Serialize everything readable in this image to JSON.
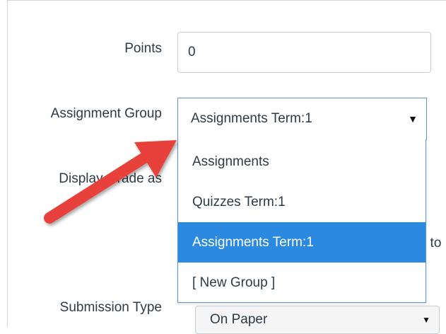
{
  "form": {
    "points": {
      "label": "Points",
      "value": "0"
    },
    "assignment_group": {
      "label": "Assignment Group",
      "selected": "Assignments Term:1",
      "options": [
        "Assignments",
        "Quizzes Term:1",
        "Assignments Term:1",
        "[ New Group ]"
      ],
      "highlighted_index": 2
    },
    "display_grade": {
      "label": "Display Grade as"
    },
    "partial_right_text": "t to",
    "submission_type": {
      "label": "Submission Type",
      "value": "On Paper"
    }
  },
  "annotation": {
    "arrow_color": "#e8413a"
  },
  "colors": {
    "highlight": "#2b8ae0",
    "focus_border": "#5b93d3",
    "text": "#2d3b45"
  }
}
